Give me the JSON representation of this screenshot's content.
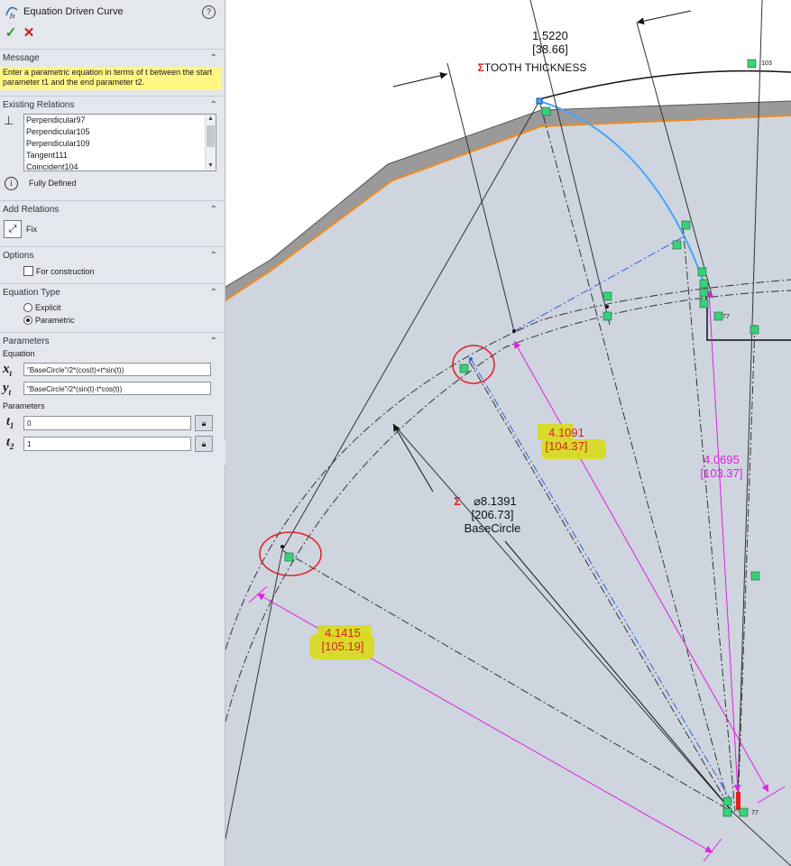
{
  "panel": {
    "title": "Equation Driven Curve",
    "help_label": "?",
    "ok_label": "✓",
    "cancel_label": "✕",
    "message": {
      "header": "Message",
      "text": "Enter a parametric equation in terms of t between the start parameter t1 and the end parameter t2."
    },
    "existing_relations": {
      "header": "Existing Relations",
      "items": [
        "Perpendicular97",
        "Perpendicular105",
        "Perpendicular109",
        "Tangent111",
        "Coincident104"
      ],
      "status": "Fully Defined"
    },
    "add_relations": {
      "header": "Add Relations",
      "fix_label": "Fix"
    },
    "options": {
      "header": "Options",
      "construction_label": "For construction"
    },
    "equation_type": {
      "header": "Equation Type",
      "explicit_label": "Explicit",
      "parametric_label": "Parametric",
      "selected": "Parametric"
    },
    "parameters": {
      "header": "Parameters",
      "equation_label": "Equation",
      "xt_symbol": "x",
      "yt_symbol": "y",
      "t_sub": "t",
      "xt_value": "\"BaseCircle\"/2*(cos(t)+t*sin(t))",
      "yt_value": "\"BaseCircle\"/2*(sin(t)-t*cos(t))",
      "params_label": "Parameters",
      "t_symbol": "t",
      "t1_sub": "1",
      "t2_sub": "2",
      "t1_value": "0",
      "t2_value": "1"
    }
  },
  "graphics": {
    "dims": {
      "tooth": {
        "v1": "1.5220",
        "v2": "[38.66]",
        "sigma": "Σ",
        "label": "TOOTH THICKNESS"
      },
      "d1": {
        "v1": "4.1091",
        "v2": "[104.37]"
      },
      "d2": {
        "v1": "4.0695",
        "v2": "[103.37]"
      },
      "d3": {
        "v1": "4.1415",
        "v2": "[105.19]"
      },
      "base": {
        "sigma": "Σ",
        "v1": "⌀8.1391",
        "v2": "[206.73]",
        "label": "BaseCircle"
      }
    },
    "tags": {
      "t103": "103",
      "t77a": "77",
      "t77b": "77"
    },
    "colors": {
      "panel_bg": "#e4e7ec",
      "canvas_bg": "#ced5df",
      "message_bg": "#fff683",
      "curve_blue": "#4aa3ff",
      "dim_magenta": "#e020e0",
      "highlight": "#d8dc1a",
      "annotation_red": "#e02020",
      "gear_orange": "#f08a20"
    }
  }
}
